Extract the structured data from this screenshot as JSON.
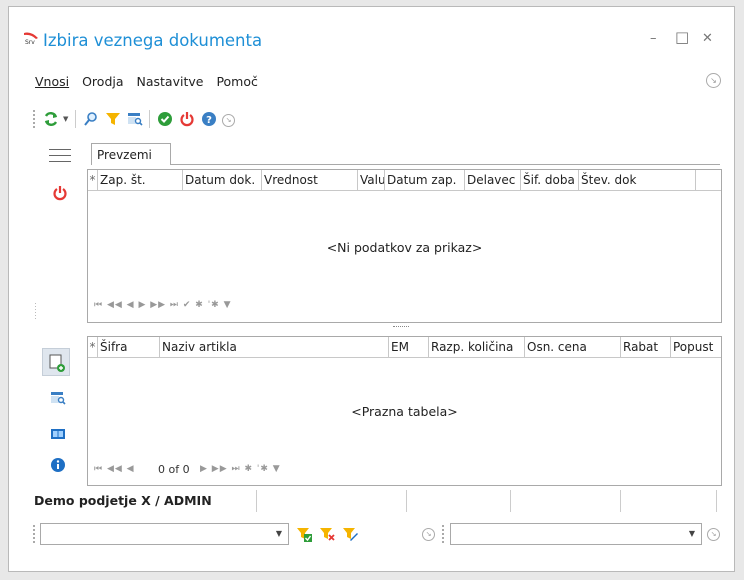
{
  "window": {
    "title": "Izbira veznega dokumenta",
    "min": "–",
    "max": "□",
    "close": "✕"
  },
  "menu": {
    "items": [
      "Vnosi",
      "Orodja",
      "Nastavitve",
      "Pomoč"
    ]
  },
  "tabs": {
    "active": "Prevzemi"
  },
  "grid1": {
    "columns": [
      "Zap. št.",
      "Datum dok.",
      "Vrednost",
      "Valu",
      "Datum zap.",
      "Delavec",
      "Šif. doba",
      "Štev. dok"
    ],
    "empty_text": "<Ni podatkov za prikaz>",
    "nav": "⏮  ◀◀   ◀   ▶  ▶▶  ⏭  ✔  ✱  '✱  ▼"
  },
  "grid2": {
    "columns": [
      "Šifra",
      "Naziv artikla",
      "EM",
      "Razp. količina",
      "Osn. cena",
      "Rabat",
      "Popust"
    ],
    "empty_text": "<Prazna tabela>",
    "record_text": "0 of 0",
    "nav_left": "⏮  ◀◀   ◀",
    "nav_right": "▶  ▶▶  ⏭  ✱  '✱  ▼"
  },
  "status": {
    "company": "Demo podjetje X / ADMIN"
  },
  "colors": {
    "accent": "#1e8fd6",
    "power": "#e53935",
    "ok": "#2e9d3a",
    "filter": "#f5b400"
  }
}
